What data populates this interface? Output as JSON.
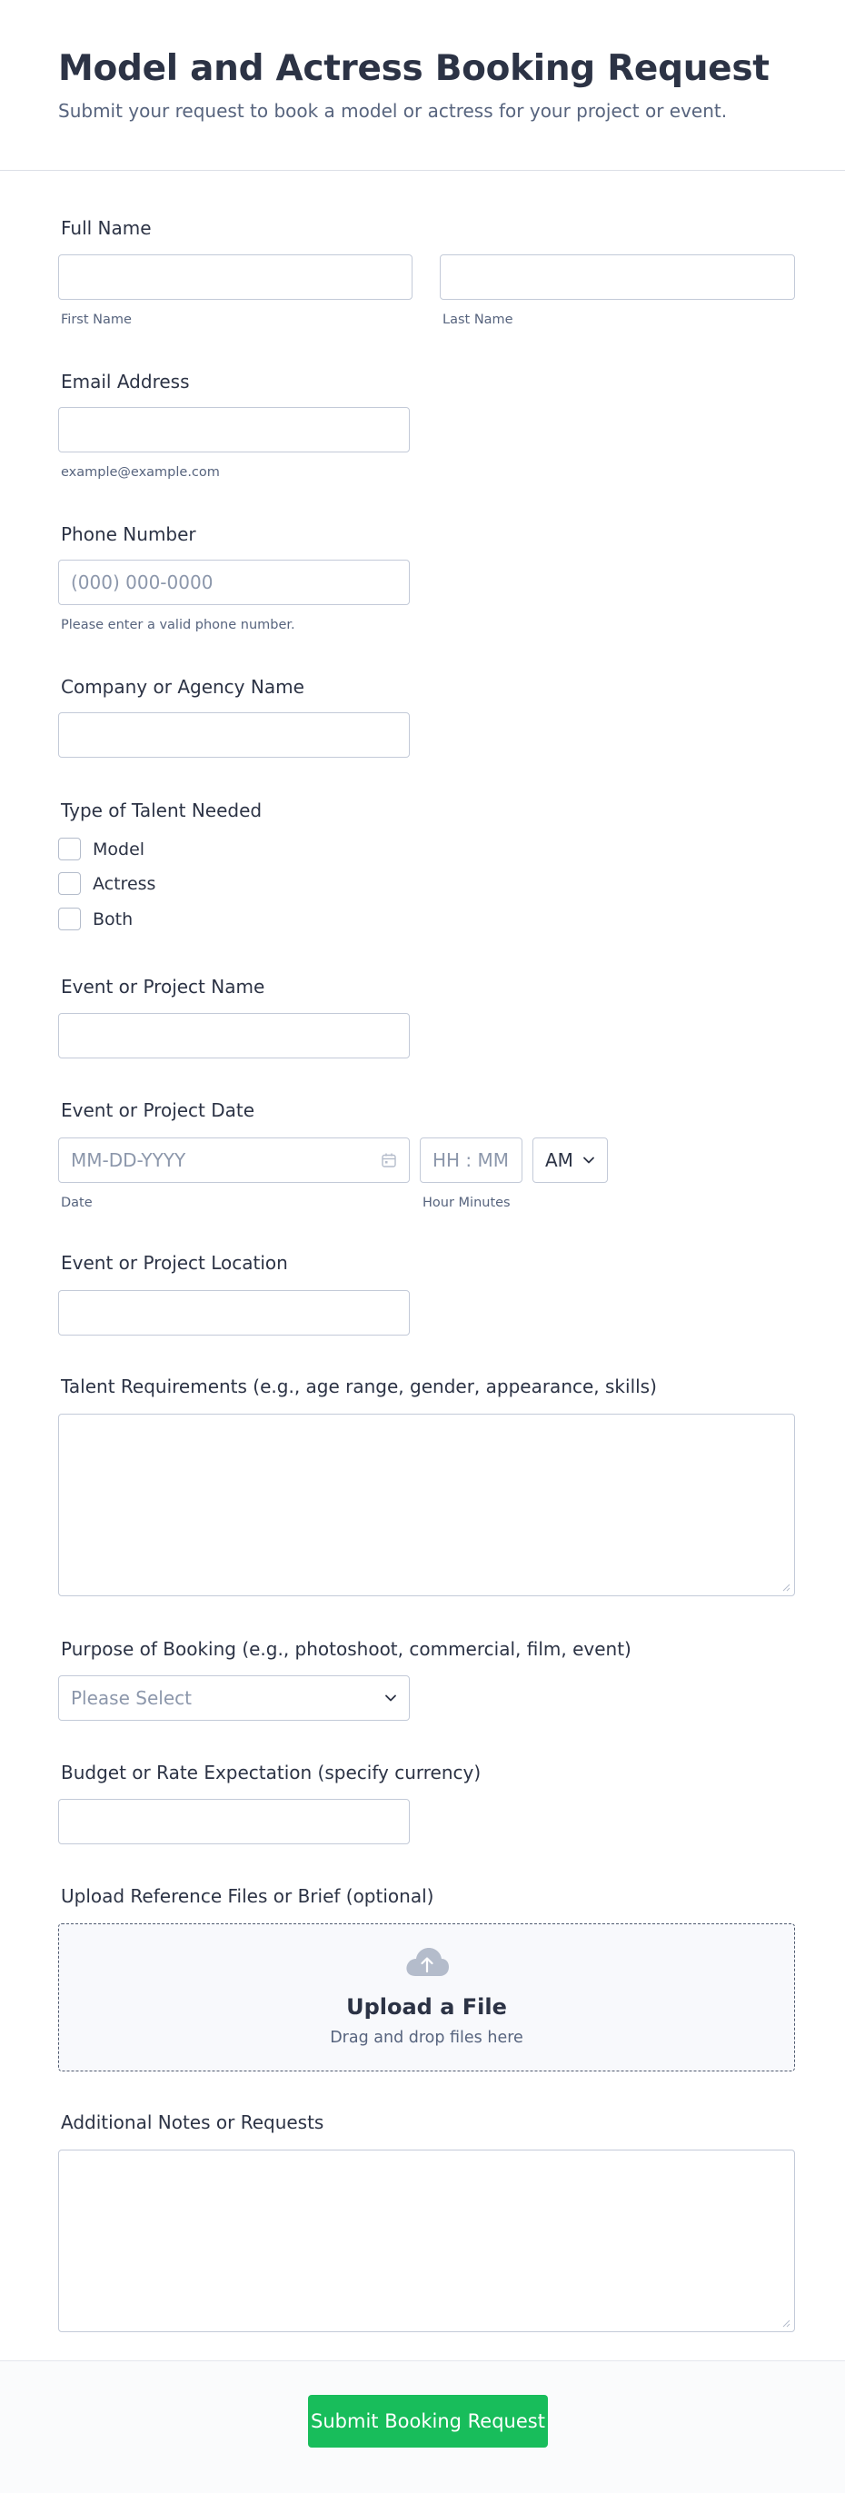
{
  "header": {
    "title": "Model and Actress Booking Request",
    "subtitle": "Submit your request to book a model or actress for your project or event."
  },
  "full_name": {
    "label": "Full Name",
    "first_sublabel": "First Name",
    "last_sublabel": "Last Name",
    "first_value": "",
    "last_value": ""
  },
  "email": {
    "label": "Email Address",
    "sublabel": "example@example.com",
    "value": ""
  },
  "phone": {
    "label": "Phone Number",
    "placeholder": "(000) 000-0000",
    "sublabel": "Please enter a valid phone number."
  },
  "company": {
    "label": "Company or Agency Name",
    "value": ""
  },
  "talent_type": {
    "label": "Type of Talent Needed",
    "options": [
      "Model",
      "Actress",
      "Both"
    ]
  },
  "event_name": {
    "label": "Event or Project Name",
    "value": ""
  },
  "event_date": {
    "label": "Event or Project Date",
    "date_placeholder": "MM-DD-YYYY",
    "time_placeholder": "HH : MM",
    "ampm_value": "AM",
    "date_sublabel": "Date",
    "time_sublabel": "Hour Minutes"
  },
  "event_location": {
    "label": "Event or Project Location",
    "value": ""
  },
  "talent_requirements": {
    "label": "Talent Requirements (e.g., age range, gender, appearance, skills)"
  },
  "purpose": {
    "label": "Purpose of Booking (e.g., photoshoot, commercial, film, event)",
    "selected": "Please Select"
  },
  "budget": {
    "label": "Budget or Rate Expectation (specify currency)",
    "value": ""
  },
  "upload": {
    "label": "Upload Reference Files or Brief (optional)",
    "title": "Upload a File",
    "subtitle": "Drag and drop files here"
  },
  "notes": {
    "label": "Additional Notes or Requests"
  },
  "footer": {
    "submit_label": "Submit Booking Request"
  },
  "colors": {
    "accent": "#18bd5b",
    "text": "#2c3345",
    "muted": "#57647e",
    "border": "#c3cad8"
  },
  "icons": {
    "calendar": "calendar-icon",
    "chevron": "chevron-down-icon",
    "upload": "cloud-upload-icon"
  }
}
